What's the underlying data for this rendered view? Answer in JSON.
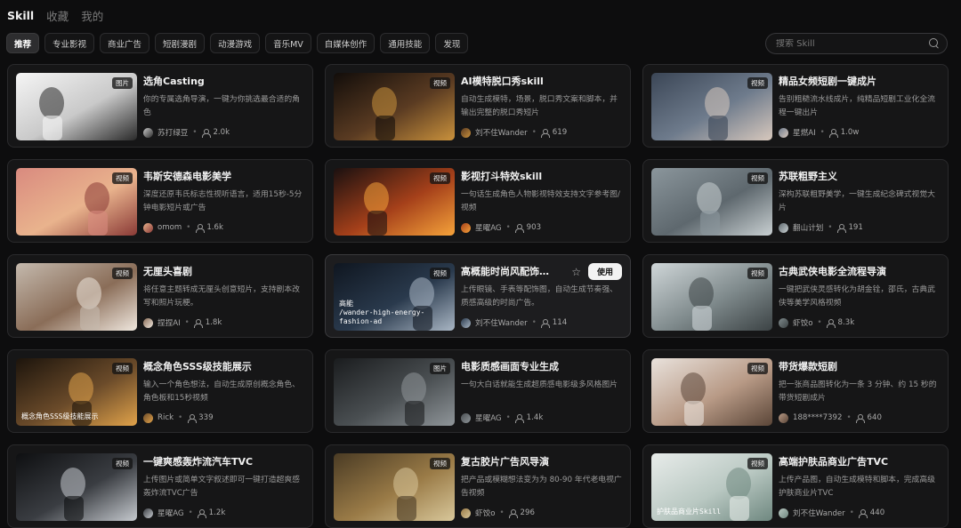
{
  "topnav": [
    "Skill",
    "收藏",
    "我的"
  ],
  "categories": [
    "推荐",
    "专业影视",
    "商业广告",
    "短剧漫剧",
    "动漫游戏",
    "音乐MV",
    "自媒体创作",
    "通用技能",
    "发现"
  ],
  "search": {
    "placeholder": "搜索 Skill"
  },
  "cards": [
    {
      "title": "选角Casting",
      "desc": "你的专属选角导演，一键为你挑选最合适的角色",
      "author": "苏打绿豆",
      "count": "2.0k",
      "badge": "图片",
      "colors": [
        "#f5f5f5",
        "#c9c9c9",
        "#2a2a2a"
      ]
    },
    {
      "title": "AI模特脱口秀skill",
      "desc": "自动生成模特，场景，脱口秀文案和脚本，并输出完整的脱口秀短片",
      "author": "刘不住Wander",
      "count": "619",
      "badge": "视频",
      "colors": [
        "#120d0a",
        "#5a3b22",
        "#c9913c"
      ]
    },
    {
      "title": "精品女频短剧一键成片",
      "desc": "告别粗糙流水线成片，纯精品短剧工业化全流程一键出片",
      "author": "星燃AI",
      "count": "1.0w",
      "badge": "视频",
      "colors": [
        "#3b4656",
        "#6e7b8c",
        "#d7c8bd"
      ]
    },
    {
      "title": "韦斯安德森电影美学",
      "desc": "深度还原韦氏标志性视听语言，适用15秒-5分钟电影短片或广告",
      "author": "omom",
      "count": "1.6k",
      "badge": "视频",
      "colors": [
        "#d98a7f",
        "#e9b38d",
        "#8a3a36"
      ]
    },
    {
      "title": "影视打斗特效skill",
      "desc": "一句话生成角色人物影视特效支持文字参考图/视频",
      "author": "星曜AG",
      "count": "903",
      "badge": "视频",
      "colors": [
        "#1a1010",
        "#a5401a",
        "#f5a23a"
      ]
    },
    {
      "title": "苏联粗野主义",
      "desc": "深构苏联粗野美学，一键生成纪念碑式视觉大片",
      "author": "翻山计划",
      "count": "191",
      "badge": "视频",
      "colors": [
        "#8b969c",
        "#5e686e",
        "#c8cfd1"
      ]
    },
    {
      "title": "无厘头喜剧",
      "desc": "将任意主题转成无厘头创意短片，支持剧本改写和照片玩梗。",
      "author": "捏捏AI",
      "count": "1.8k",
      "badge": "视频",
      "colors": [
        "#c4b9ad",
        "#8a6d58",
        "#efe7de"
      ]
    },
    {
      "title": "高概能时尚风配饰酷...",
      "desc": "上传眼镜、手表等配饰图，自动生成节奏强、质感高级的时尚广告。",
      "author": "刘不住Wander",
      "count": "114",
      "badge": "视频",
      "colors": [
        "#0f1620",
        "#2a3a4d",
        "#a9b6c4"
      ],
      "caption1": "高能",
      "caption2": "/wander-high-energy-fashion-ad"
    },
    {
      "title": "古典武侠电影全流程导演",
      "desc": "一键把武侠灵感转化为胡金铨，邵氏，古典武侠等美学风格视频",
      "author": "虾饺o",
      "count": "8.3k",
      "badge": "视频",
      "colors": [
        "#cfd6d8",
        "#7f8a8c",
        "#3c4345"
      ]
    },
    {
      "title": "概念角色SSS级技能展示",
      "desc": "输入一个角色想法，自动生成原创概念角色、角色板和15秒视频",
      "author": "Rick",
      "count": "339",
      "badge": "视频",
      "colors": [
        "#1c140c",
        "#6b4b2a",
        "#e0a24a"
      ],
      "caption1": "概念角色SSS级技能展示"
    },
    {
      "title": "电影质感画面专业生成",
      "desc": "一句大白话就能生成超质感电影级多风格图片",
      "author": "星曜AG",
      "count": "1.4k",
      "badge": "图片",
      "colors": [
        "#1a1c1e",
        "#4a4f52",
        "#8f9599"
      ]
    },
    {
      "title": "带货爆款短剧",
      "desc": "把一张商品图转化为一条 3 分钟、约 15 秒的带货短剧成片",
      "author": "188****7392",
      "count": "640",
      "badge": "视频",
      "colors": [
        "#e9e2dc",
        "#b89a86",
        "#5b4638"
      ]
    },
    {
      "title": "一键爽感轰炸流汽车TVC",
      "desc": "上传图片或简单文字叙述即可一键打造超爽感轰炸流TVC广告",
      "author": "星曜AG",
      "count": "1.2k",
      "badge": "视频",
      "colors": [
        "#0e0f11",
        "#3a3d42",
        "#c5c9ce"
      ]
    },
    {
      "title": "复古胶片广告风导演",
      "desc": "把产品或模糊想法变为为 80-90 年代老电视广告视频",
      "author": "虾饺o",
      "count": "296",
      "badge": "视频",
      "colors": [
        "#4a3b24",
        "#9a7b47",
        "#d8c79a"
      ]
    },
    {
      "title": "高端护肤品商业广告TVC",
      "desc": "上传产品图，自动生成模特和脚本，完成高级护肤商业片TVC",
      "author": "刘不住Wander",
      "count": "440",
      "badge": "视频",
      "colors": [
        "#e8ecea",
        "#b9c8c2",
        "#6f8880"
      ],
      "caption1": "护肤品商业片Skill"
    }
  ],
  "hover": {
    "use_label": "使用",
    "star": "☆"
  }
}
